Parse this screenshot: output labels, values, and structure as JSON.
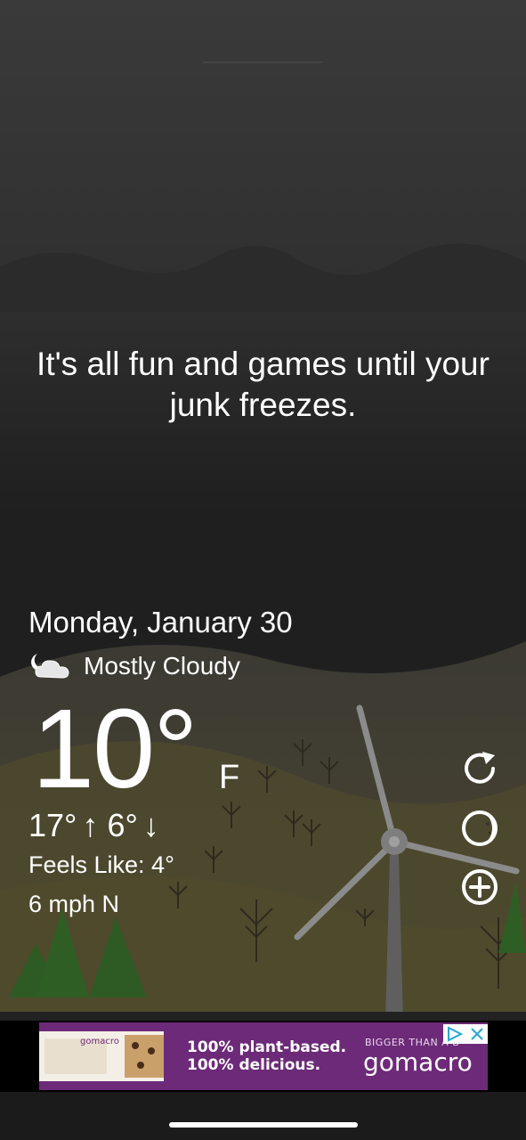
{
  "tagline": "It's all fun and games until your junk freezes.",
  "weather": {
    "date": "Monday, January 30",
    "condition": "Mostly Cloudy",
    "condition_icon": "moon-cloud-icon",
    "temperature": "10°",
    "unit": "F",
    "high": "17°",
    "low": "6°",
    "high_arrow": "↑",
    "low_arrow": "↓",
    "feels_like": "Feels Like: 4°",
    "wind": "6 mph N"
  },
  "side_buttons": [
    "refresh-icon",
    "moon-phase-icon",
    "add-icon"
  ],
  "ad": {
    "line1": "100% plant-based.",
    "line2": "100% delicious.",
    "tag": "BIGGER THAN A B",
    "brand": "gomacro"
  },
  "colors": {
    "background": "#1e1e1e",
    "hills": "#4a4430",
    "ad_purple": "#6d2a79"
  }
}
